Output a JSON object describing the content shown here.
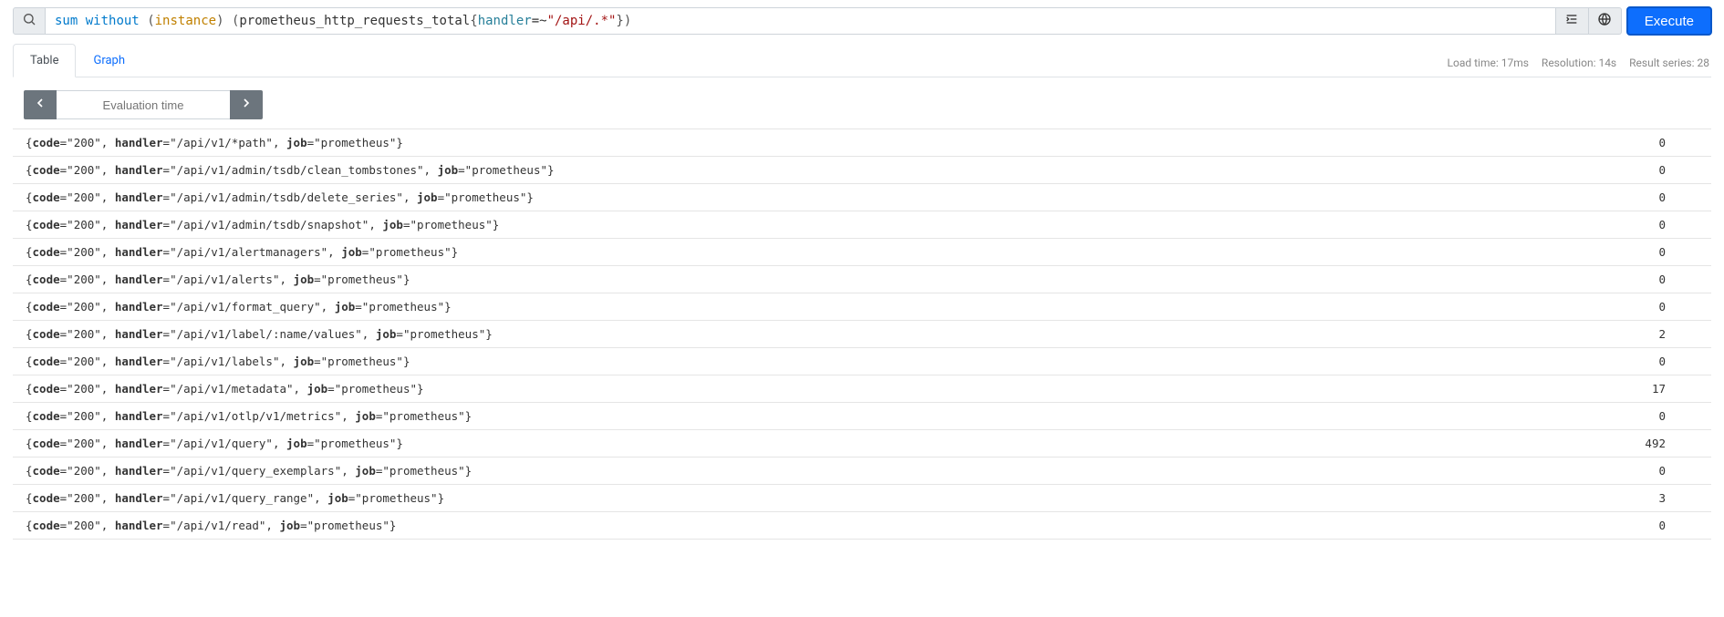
{
  "query": {
    "raw": "sum without (instance) (prometheus_http_requests_total{handler=~\"/api/.*\"})",
    "kw_sum": "sum",
    "kw_without": "without",
    "group": "instance",
    "metric": "prometheus_http_requests_total",
    "label_key": "handler",
    "op": "=~",
    "label_val": "\"/api/.*\""
  },
  "buttons": {
    "execute": "Execute"
  },
  "tabs": {
    "table": "Table",
    "graph": "Graph"
  },
  "stats": {
    "load_time": "Load time: 17ms",
    "resolution": "Resolution: 14s",
    "result_series": "Result series: 28"
  },
  "eval_time": {
    "placeholder": "Evaluation time"
  },
  "labels": {
    "code": "code",
    "handler": "handler",
    "job": "job"
  },
  "results": [
    {
      "code": "200",
      "handler": "/api/v1/*path",
      "job": "prometheus",
      "value": "0"
    },
    {
      "code": "200",
      "handler": "/api/v1/admin/tsdb/clean_tombstones",
      "job": "prometheus",
      "value": "0"
    },
    {
      "code": "200",
      "handler": "/api/v1/admin/tsdb/delete_series",
      "job": "prometheus",
      "value": "0"
    },
    {
      "code": "200",
      "handler": "/api/v1/admin/tsdb/snapshot",
      "job": "prometheus",
      "value": "0"
    },
    {
      "code": "200",
      "handler": "/api/v1/alertmanagers",
      "job": "prometheus",
      "value": "0"
    },
    {
      "code": "200",
      "handler": "/api/v1/alerts",
      "job": "prometheus",
      "value": "0"
    },
    {
      "code": "200",
      "handler": "/api/v1/format_query",
      "job": "prometheus",
      "value": "0"
    },
    {
      "code": "200",
      "handler": "/api/v1/label/:name/values",
      "job": "prometheus",
      "value": "2"
    },
    {
      "code": "200",
      "handler": "/api/v1/labels",
      "job": "prometheus",
      "value": "0"
    },
    {
      "code": "200",
      "handler": "/api/v1/metadata",
      "job": "prometheus",
      "value": "17"
    },
    {
      "code": "200",
      "handler": "/api/v1/otlp/v1/metrics",
      "job": "prometheus",
      "value": "0"
    },
    {
      "code": "200",
      "handler": "/api/v1/query",
      "job": "prometheus",
      "value": "492"
    },
    {
      "code": "200",
      "handler": "/api/v1/query_exemplars",
      "job": "prometheus",
      "value": "0"
    },
    {
      "code": "200",
      "handler": "/api/v1/query_range",
      "job": "prometheus",
      "value": "3"
    },
    {
      "code": "200",
      "handler": "/api/v1/read",
      "job": "prometheus",
      "value": "0"
    }
  ]
}
